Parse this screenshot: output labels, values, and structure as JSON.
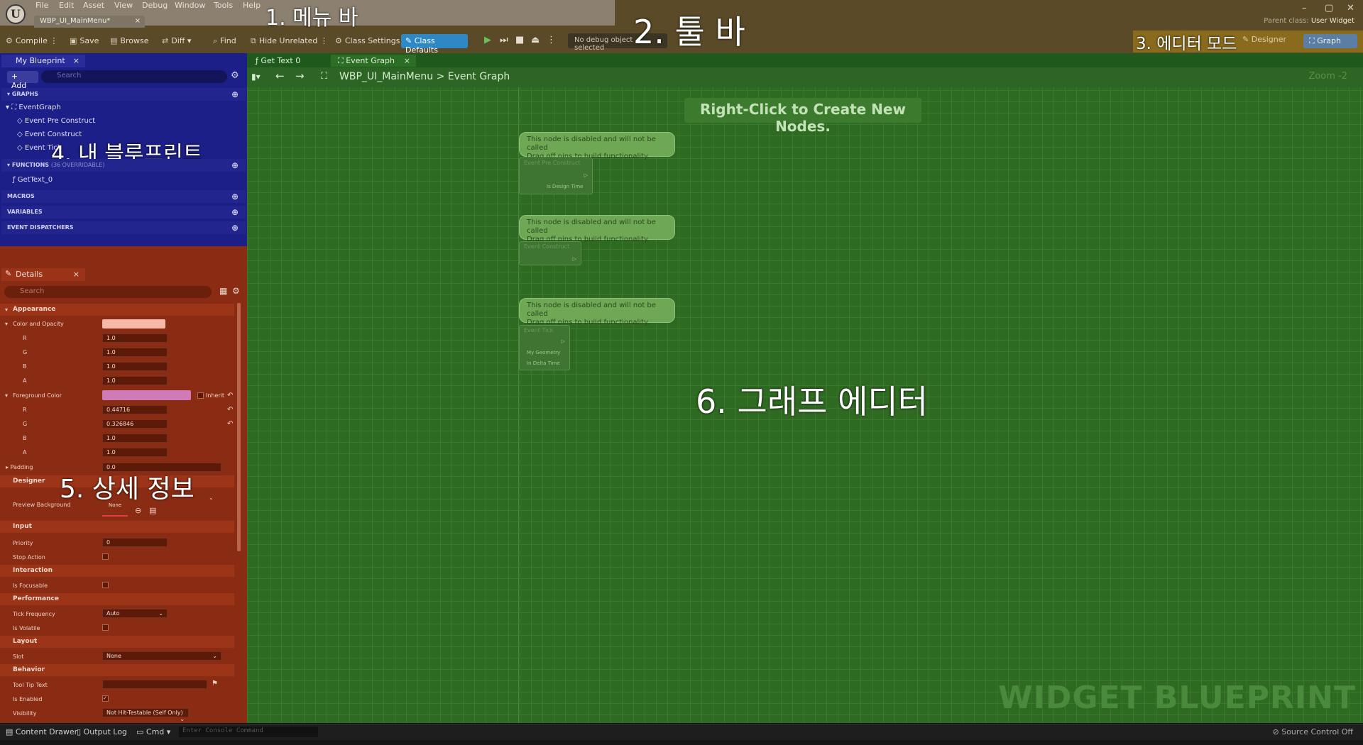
{
  "title_bar": {
    "logo": "U",
    "menus": [
      "File",
      "Edit",
      "Asset",
      "View",
      "Debug",
      "Window",
      "Tools",
      "Help"
    ],
    "doc_tab": "WBP_UI_MainMenu*",
    "parent_class_label": "Parent class:",
    "parent_class_value": "User Widget",
    "window_controls": {
      "minimize": "–",
      "maximize": "▢",
      "close": "✕"
    }
  },
  "toolbar": {
    "compile": "Compile",
    "save": "Save",
    "browse": "Browse",
    "diff": "Diff",
    "find": "Find",
    "hide_unrelated": "Hide Unrelated",
    "class_settings": "Class Settings",
    "class_defaults": "Class Defaults",
    "debug_object": "No debug object selected"
  },
  "editor_modes": {
    "designer": "Designer",
    "graph": "Graph"
  },
  "overlay_labels": {
    "menu_bar": "1. 메뉴 바",
    "toolbar": "2. 툴 바",
    "editor_mode": "3. 에디터 모드",
    "my_blueprint": "4. 내 블루프린트",
    "details": "5. 상세 정보",
    "graph_editor": "6. 그래프 에디터"
  },
  "my_blueprint": {
    "tab": "My Blueprint",
    "add": "Add",
    "search_placeholder": "Search",
    "graphs_header": "GRAPHS",
    "event_graph": "EventGraph",
    "events": [
      "Event Pre Construct",
      "Event Construct",
      "Event Tick"
    ],
    "functions_header": "FUNCTIONS",
    "functions_overridable": "(36 OVERRIDABLE)",
    "functions": [
      "GetText_0"
    ],
    "macros_header": "MACROS",
    "variables_header": "VARIABLES",
    "dispatchers_header": "EVENT DISPATCHERS"
  },
  "details": {
    "tab": "Details",
    "search_placeholder": "Search",
    "categories": {
      "appearance": "Appearance",
      "designer": "Designer",
      "input": "Input",
      "interaction": "Interaction",
      "performance": "Performance",
      "layout": "Layout",
      "behavior": "Behavior"
    },
    "color_opacity": {
      "label": "Color and Opacity",
      "swatch": "#f7b8a8",
      "r_label": "R",
      "g_label": "G",
      "b_label": "B",
      "a_label": "A",
      "r": "1.0",
      "g": "1.0",
      "b": "1.0",
      "a": "1.0"
    },
    "foreground": {
      "label": "Foreground Color",
      "swatch": "#d07ab8",
      "inherit": "Inherit",
      "r_label": "R",
      "g_label": "G",
      "b_label": "B",
      "a_label": "A",
      "r": "0.44716",
      "g": "0.326846",
      "b": "1.0",
      "a": "1.0"
    },
    "padding": {
      "label": "Padding",
      "value": "0.0"
    },
    "preview_background": {
      "label": "Preview Background",
      "value": "None"
    },
    "priority": {
      "label": "Priority",
      "value": "0"
    },
    "stop_action": "Stop Action",
    "is_focusable": "Is Focusable",
    "tick_frequency": {
      "label": "Tick Frequency",
      "value": "Auto"
    },
    "is_volatile": "Is Volatile",
    "slot": {
      "label": "Slot",
      "value": "None"
    },
    "tooltip_text": "Tool Tip Text",
    "is_enabled": "Is Enabled",
    "visibility": {
      "label": "Visibility",
      "value": "Not Hit-Testable (Self Only)"
    }
  },
  "graph": {
    "tabs": [
      "Get Text 0",
      "Event Graph"
    ],
    "breadcrumb_root": "WBP_UI_MainMenu",
    "breadcrumb_sep": ">",
    "breadcrumb_leaf": "Event Graph",
    "zoom": "Zoom -2",
    "hint": "Right-Click to Create New Nodes.",
    "comment_line1": "This node is disabled and will not be called",
    "comment_line2": "Drag off pins to build functionality.",
    "nodes": [
      {
        "title": "Event Pre Construct",
        "pins": [
          "Is Design Time"
        ]
      },
      {
        "title": "Event Construct",
        "pins": []
      },
      {
        "title": "Event Tick",
        "pins": [
          "My Geometry",
          "In Delta Time"
        ]
      }
    ],
    "watermark": "WIDGET BLUEPRINT"
  },
  "status_bar": {
    "content_drawer": "Content Drawer",
    "output_log": "Output Log",
    "cmd": "Cmd",
    "console_placeholder": "Enter Console Command",
    "source_control": "Source Control Off"
  }
}
